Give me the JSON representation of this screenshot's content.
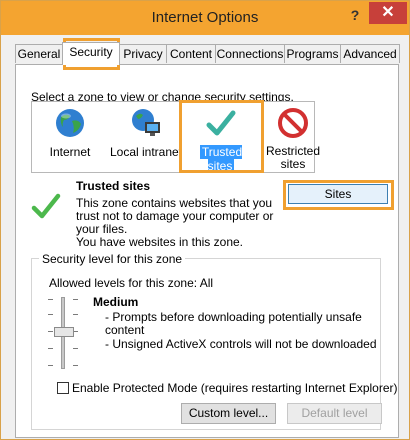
{
  "window": {
    "title": "Internet Options",
    "help_glyph": "?",
    "close_glyph": "✕"
  },
  "tabs": [
    {
      "label": "General"
    },
    {
      "label": "Security",
      "selected": true
    },
    {
      "label": "Privacy"
    },
    {
      "label": "Content"
    },
    {
      "label": "Connections"
    },
    {
      "label": "Programs"
    },
    {
      "label": "Advanced"
    }
  ],
  "security": {
    "zone_prompt": "Select a zone to view or change security settings.",
    "zones": [
      {
        "label": "Internet",
        "icon": "globe-icon"
      },
      {
        "label": "Local intranet",
        "icon": "intranet-icon"
      },
      {
        "label": "Trusted sites",
        "icon": "checkmark-icon",
        "selected": true
      },
      {
        "label_line1": "Restricted",
        "label_line2": "sites",
        "icon": "restricted-icon"
      }
    ],
    "selected_zone": {
      "title": "Trusted sites",
      "description_lines": [
        "This zone contains websites that you",
        "trust not to damage your computer or",
        "your files.",
        "You have websites in this zone."
      ],
      "sites_button": "Sites"
    },
    "level_group": {
      "title": "Security level for this zone",
      "allowed": "Allowed levels for this zone: All",
      "level_name": "Medium",
      "bullets": [
        "- Prompts before downloading potentially unsafe",
        "content",
        "- Unsigned ActiveX controls will not be downloaded"
      ],
      "protected_mode_label": "Enable Protected Mode (requires restarting Internet Explorer)",
      "protected_mode_checked": false,
      "custom_level_button": "Custom level...",
      "default_level_button": "Default level"
    }
  },
  "colors": {
    "titlebar": "#f4a430",
    "close": "#c7403a",
    "highlight": "#f0a030",
    "selection": "#3399ff"
  }
}
